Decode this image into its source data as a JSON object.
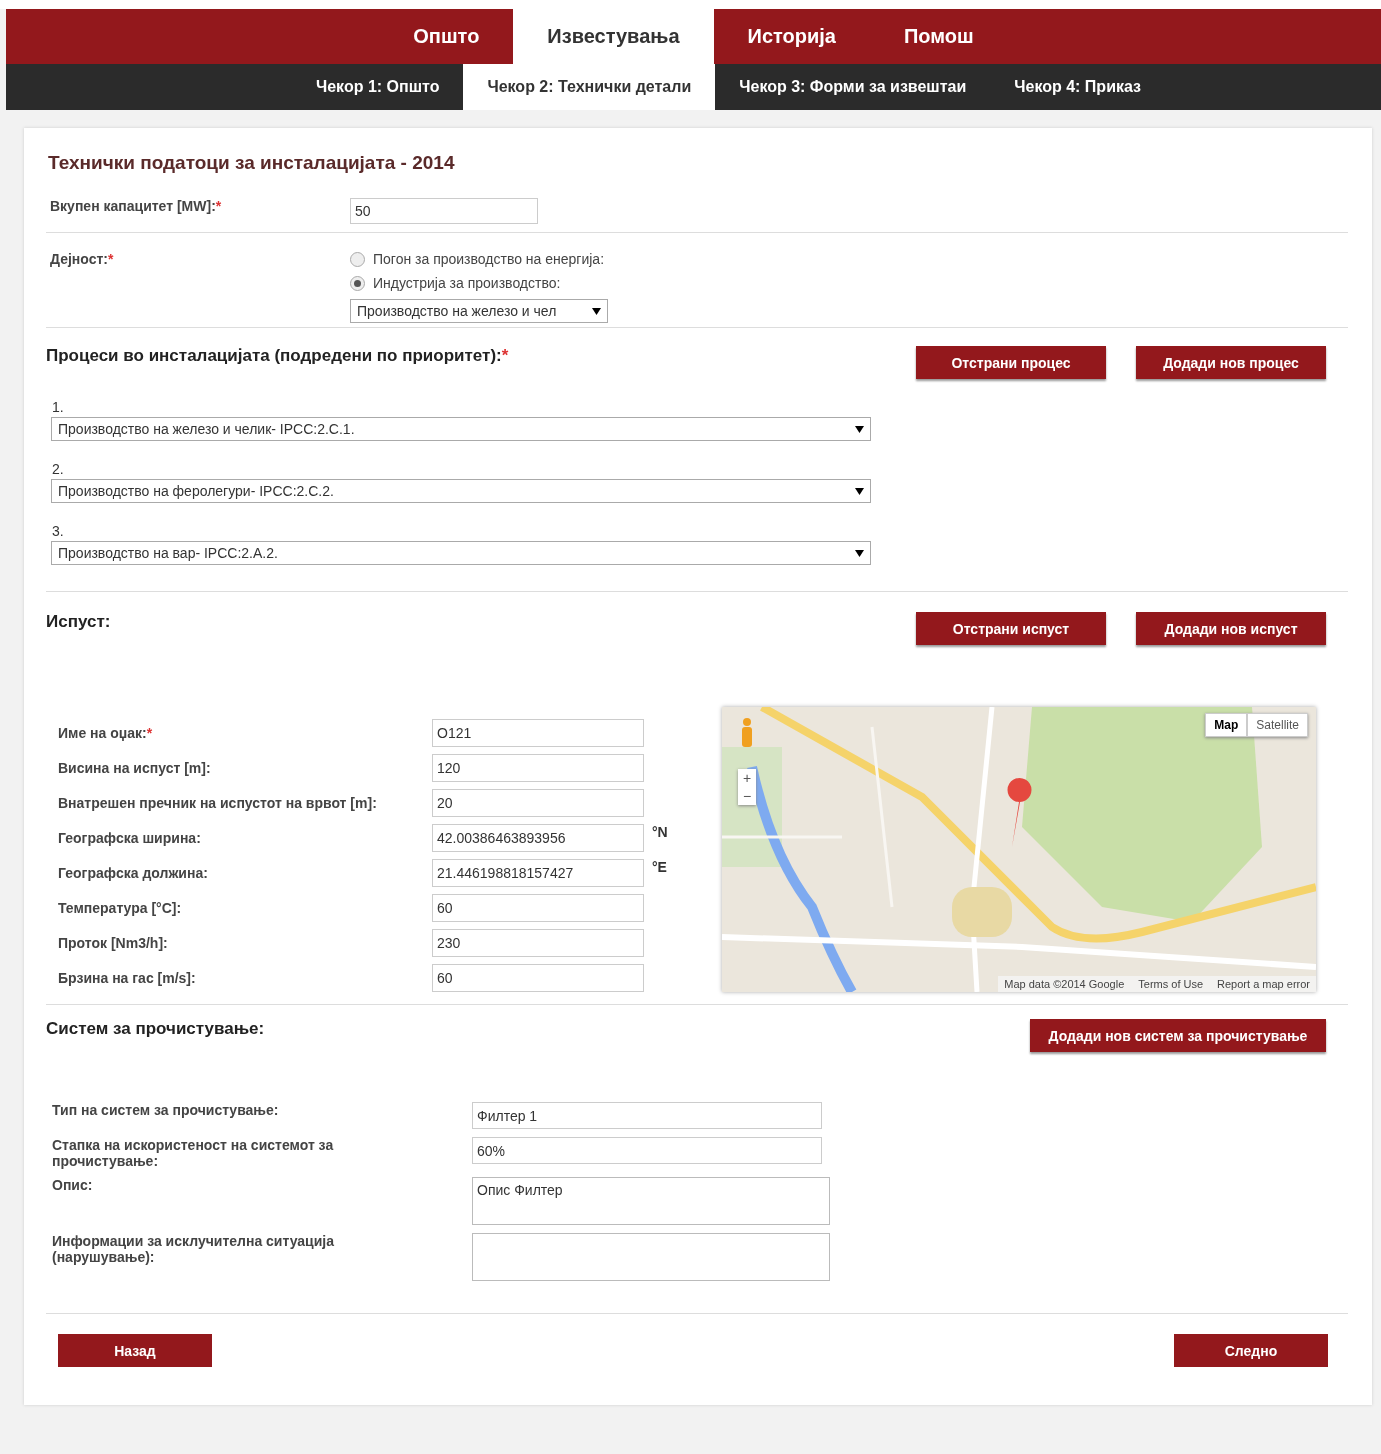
{
  "main_tabs": [
    {
      "label": "Општо",
      "selected": false
    },
    {
      "label": "Известувања",
      "selected": true
    },
    {
      "label": "Историја",
      "selected": false
    },
    {
      "label": "Помош",
      "selected": false
    }
  ],
  "steps": [
    {
      "label": "Чекор 1: Општо",
      "selected": false
    },
    {
      "label": "Чекор 2: Технички детали",
      "selected": true
    },
    {
      "label": "Чекор 3: Форми за извештаи",
      "selected": false
    },
    {
      "label": "Чекор 4: Приказ",
      "selected": false
    }
  ],
  "title": "Технички податоци за инсталацијата - 2014",
  "capacity": {
    "label": "Вкупен капацитет [MW]:",
    "mark": "*",
    "value": "50"
  },
  "activity": {
    "label": "Дејност:",
    "mark": "*",
    "options": [
      {
        "label": "Погон за производство на енергија:",
        "selected": false
      },
      {
        "label": "Индустрија за производство:",
        "selected": true
      }
    ],
    "select": "Производство на железо и чел"
  },
  "processes": {
    "title": "Процеси во инсталацијата (подредени по приоритет):",
    "mark": "*",
    "buttons": [
      "Отстрани процес",
      "Додади нов процес"
    ],
    "items": [
      {
        "number": "1.",
        "value": "Производство на железо и челик- IPCC:2.C.1."
      },
      {
        "number": "2.",
        "value": "Производство на феролегури- IPCC:2.C.2."
      },
      {
        "number": "3.",
        "value": "Производство на вар- IPCC:2.A.2."
      }
    ]
  },
  "emission": {
    "title": "Испуст:",
    "buttons": [
      "Отстрани испуст",
      "Додади нов испуст"
    ],
    "fields": [
      {
        "label": "Име на оџак:",
        "mark": "*",
        "value": "O121"
      },
      {
        "label": "Висина на испуст [m]:",
        "value": "120"
      },
      {
        "label": "Внатрешен пречник на испустот на врвот [m]:",
        "value": "20"
      },
      {
        "label": "Географска ширина:",
        "value": "42.00386463893956",
        "unit": "°N"
      },
      {
        "label": "Географска должина:",
        "value": "21.446198818157427",
        "unit": "°E"
      },
      {
        "label": "Температура [°C]:",
        "value": "60"
      },
      {
        "label": "Проток [Nm3/h]:",
        "value": "230"
      },
      {
        "label": "Брзина на гас [m/s]:",
        "value": "60"
      }
    ],
    "map": {
      "kind": "picture",
      "types": [
        {
          "label": "Map",
          "selected": true
        },
        {
          "label": "Satellite",
          "selected": false
        }
      ],
      "zoom": [
        "+",
        "−"
      ],
      "footer": [
        "Map data ©2014 Google",
        "Terms of Use",
        "Report a map error"
      ]
    }
  },
  "cleaning": {
    "title": "Систем за прочистување:",
    "button": "Додади нов систем за прочистување",
    "fields": [
      {
        "kind": "input",
        "label": "Тип на систем за прочистување:",
        "value": "Филтер 1"
      },
      {
        "kind": "input",
        "label": "Стапка на искористеност на системот за прочистување:",
        "value": "60%"
      },
      {
        "kind": "textarea",
        "label": "Опис:",
        "value": "Опис Филтер"
      },
      {
        "kind": "textarea",
        "label": "Информации за исклучителна ситуација (нарушување):"
      }
    ]
  },
  "nav": {
    "back": "Назад",
    "next": "Следно"
  }
}
